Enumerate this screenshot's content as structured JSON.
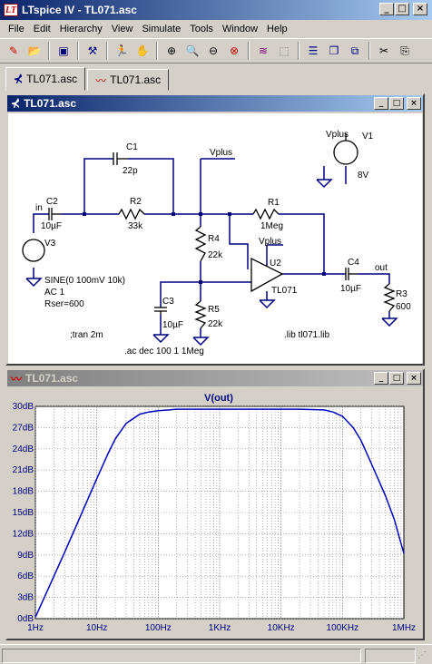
{
  "app": {
    "title": "LTspice IV - TL071.asc"
  },
  "menu": [
    "File",
    "Edit",
    "Hierarchy",
    "View",
    "Simulate",
    "Tools",
    "Window",
    "Help"
  ],
  "toolbar": [
    "new-schematic-icon",
    "open-folder-icon",
    "save-icon",
    "control-panel-icon",
    "run-icon",
    "halt-icon",
    "zoom-in-icon",
    "pan-icon",
    "zoom-out-icon",
    "zoom-cancel-icon",
    "autoscale-icon",
    "zoom-extents-icon",
    "tile-horizontal-icon",
    "cascade-icon",
    "close-window-icon",
    "cut-icon",
    "copy-icon"
  ],
  "tabs": [
    {
      "label": "TL071.asc"
    },
    {
      "label": "TL071.asc"
    }
  ],
  "schematic": {
    "title": "TL071.asc",
    "labels": {
      "c1": "C1",
      "c1v": "22p",
      "c2": "C2",
      "c2v": "10µF",
      "in": "in",
      "r2": "R2",
      "r2v": "33k",
      "r1": "R1",
      "r1v": "1Meg",
      "vplus1": "Vplus",
      "vplus2": "Vplus",
      "vplus3": "Vplus",
      "v1": "V1",
      "v1v": "8V",
      "v3": "V3",
      "v3spec1": "SINE(0 100mV 10k)",
      "v3spec2": "AC 1",
      "v3spec3": "Rser=600",
      "r4": "R4",
      "r4v": "22k",
      "r5": "R5",
      "r5v": "22k",
      "c3": "C3",
      "c3v": "10µF",
      "u2": "U2",
      "u2v": "TL071",
      "c4": "C4",
      "c4v": "10µF",
      "out": "out",
      "r3": "R3",
      "r3v": "600",
      "tran": ";tran 2m",
      "ac": ".ac dec 100 1 1Meg",
      "lib": ".lib tl071.lib"
    }
  },
  "plot_window": {
    "title": "TL071.asc"
  },
  "chart_data": {
    "type": "line",
    "title": "V(out)",
    "xscale": "log",
    "xlim": [
      1,
      1000000
    ],
    "ylim": [
      0,
      30
    ],
    "x_ticks": [
      "1Hz",
      "10Hz",
      "100Hz",
      "1KHz",
      "10KHz",
      "100KHz",
      "1MHz"
    ],
    "y_ticks": [
      "0dB",
      "3dB",
      "6dB",
      "9dB",
      "12dB",
      "15dB",
      "18dB",
      "21dB",
      "24dB",
      "27dB",
      "30dB"
    ],
    "grid": true,
    "color": "#0000c0",
    "series": [
      {
        "x": [
          1,
          2,
          3,
          5,
          7,
          10,
          15,
          20,
          30,
          50,
          70,
          100,
          150,
          200,
          300,
          500,
          1000,
          10000,
          20000,
          50000,
          70000,
          100000,
          150000,
          200000,
          300000,
          500000,
          700000,
          1000000
        ],
        "y": [
          0.2,
          6.0,
          9.4,
          13.8,
          16.7,
          19.8,
          23.2,
          25.4,
          27.6,
          28.9,
          29.2,
          29.4,
          29.5,
          29.6,
          29.6,
          29.6,
          29.6,
          29.6,
          29.6,
          29.5,
          29.2,
          28.6,
          27.0,
          25.2,
          21.8,
          17.4,
          14.0,
          9.2
        ]
      }
    ]
  }
}
